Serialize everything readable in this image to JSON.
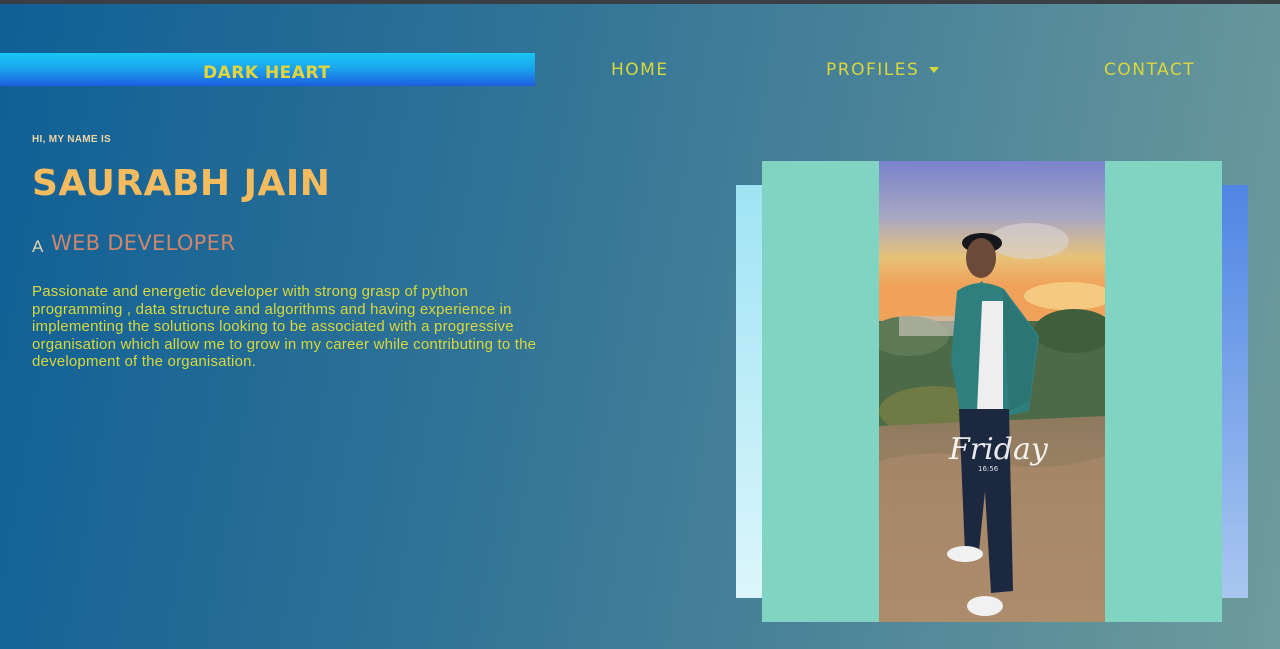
{
  "brand": {
    "name": "DARK HEART"
  },
  "nav": {
    "home": "HOME",
    "profiles": "PROFILES",
    "contact": "CONTACT"
  },
  "hero": {
    "intro": "HI, MY NAME IS",
    "name": "SAURABH JAIN",
    "role_prefix": "A",
    "role": "WEB DEVELOPER",
    "bio": "Passionate and energetic developer with strong grasp of python programming , data structure and algorithms and having experience in implementing the solutions looking to be associated with a progressive organisation which allow me to grow in my career while contributing to the development of the organisation."
  },
  "photo": {
    "overlay_day": "Friday",
    "overlay_time": "16:56"
  },
  "colors": {
    "accent_yellow": "#d9d83a",
    "name_orange": "#f5bc5f",
    "frame_teal": "#80d4c1"
  }
}
